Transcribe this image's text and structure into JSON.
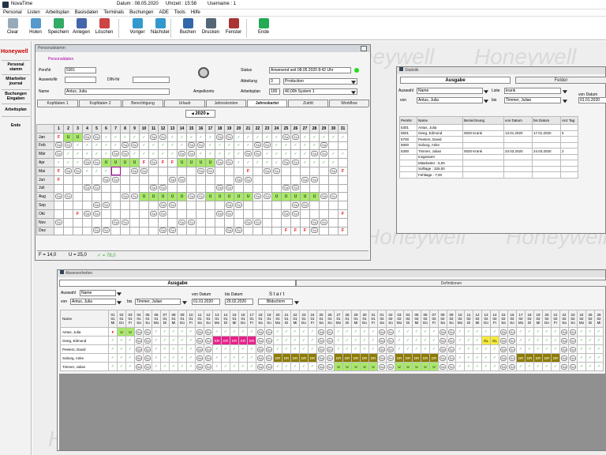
{
  "app": {
    "title": "NovaTime",
    "date_label": "Datum : 08.05.2020",
    "time_label": "Uhrzeit : 15:58",
    "user_label": "Username : 1"
  },
  "menu": [
    "Personal",
    "Listen",
    "Arbeitsplan",
    "Basisdaten",
    "Terminals",
    "Buchungen",
    "ADE",
    "Tools",
    "Hilfe"
  ],
  "toolbar": [
    {
      "name": "clear",
      "label": "Clear",
      "icon": "clear-icon",
      "color": "#9ab"
    },
    {
      "name": "holen",
      "label": "Holen",
      "icon": "fetch-icon",
      "color": "#59c"
    },
    {
      "name": "speichern",
      "label": "Speichern",
      "icon": "save-icon",
      "color": "#3a6"
    },
    {
      "name": "anlegen",
      "label": "Anlegen",
      "icon": "create-icon",
      "color": "#46a"
    },
    {
      "name": "loeschen",
      "label": "Löschen",
      "icon": "delete-icon",
      "color": "#c44"
    },
    {
      "name": "voriger",
      "label": "Voriger",
      "icon": "previous-icon",
      "color": "#39c"
    },
    {
      "name": "naechster",
      "label": "Nächster",
      "icon": "next-icon",
      "color": "#39c"
    },
    {
      "name": "buchen",
      "label": "Buchen",
      "icon": "booking-icon",
      "color": "#36a"
    },
    {
      "name": "drucken",
      "label": "Drucken",
      "icon": "print-icon",
      "color": "#567"
    },
    {
      "name": "fenster",
      "label": "Fenster",
      "icon": "window-icon",
      "color": "#a33"
    },
    {
      "name": "ende",
      "label": "Ende",
      "icon": "exit-icon",
      "color": "#2a5"
    }
  ],
  "nav": {
    "brand": "Honeywell",
    "items": [
      "Personal stamm",
      "Mitarbeiter journal",
      "Buchungen Eingaben",
      "Arbeitsplan",
      "Ende"
    ]
  },
  "watermark": "Honeywell",
  "personal": {
    "title": "Personalstamm",
    "section": "Personaldaten",
    "persnr_label": "PersNr",
    "persnr": "5301",
    "ausweis_label": "AusweisNr",
    "ausweis": "",
    "din_label": "DIN-Nr",
    "din": "",
    "name_label": "Name",
    "name": "Antus, Julia",
    "ampel_label": "Ampelkonto",
    "status_label": "Status",
    "status": "Anwesend seit  08.05.2020  8:42  Uhr",
    "abteilung_label": "Abteilung",
    "abteilung_nr": "3",
    "abteilung": "Production",
    "arbeitsplan_label": "Arbeitsplan",
    "arbeitsplan_nr": "100",
    "arbeitsplan": "40,00h System 1",
    "tabs": [
      "Kopfdaten 1",
      "Kopfdaten 2",
      "Berechtigung",
      "Urlaub",
      "Jahreskonten",
      "Jahreskartei",
      "Zutritt",
      "Workflow"
    ],
    "active_tab": 5,
    "year": "2020",
    "prev": "◀",
    "next": "▶",
    "days": [
      "1",
      "2",
      "3",
      "4",
      "5",
      "6",
      "7",
      "8",
      "9",
      "10",
      "11",
      "12",
      "13",
      "14",
      "15",
      "16",
      "17",
      "18",
      "19",
      "20",
      "21",
      "22",
      "23",
      "24",
      "25",
      "26",
      "27",
      "28",
      "29",
      "30",
      "31"
    ],
    "months": [
      {
        "m": "Jan",
        "c": [
          "F",
          "U",
          "U",
          "Sa",
          "So",
          "✓",
          "✓",
          "✓",
          "✓",
          "✓",
          "Sa",
          "So",
          "✓",
          "✓",
          "✓",
          "✓",
          "✓",
          "Sa",
          "So",
          "✓",
          "✓",
          "✓",
          "✓",
          "✓",
          "Sa",
          "So",
          "✓",
          "✓",
          "✓",
          "✓",
          "✓"
        ]
      },
      {
        "m": "Feb",
        "c": [
          "Sa",
          "So",
          "✓",
          "✓",
          "✓",
          "✓",
          "✓",
          "Sa",
          "So",
          "✓",
          "✓",
          "✓",
          "✓",
          "✓",
          "Sa",
          "So",
          "✓",
          "✓",
          "✓",
          "✓",
          "✓",
          "Sa",
          "So",
          "✓",
          "✓",
          "✓",
          "✓",
          "✓",
          "Sa",
          "",
          ""
        ]
      },
      {
        "m": "Mär",
        "c": [
          "So",
          "✓",
          "✓",
          "✓",
          "✓",
          "✓",
          "Sa",
          "So",
          "✓",
          "✓",
          "✓",
          "✓",
          "✓",
          "Sa",
          "So",
          "✓",
          "✓",
          "✓",
          "✓",
          "✓",
          "Sa",
          "So",
          "✓",
          "✓",
          "✓",
          "✓",
          "✓",
          "Sa",
          "So",
          "✓",
          "✓"
        ]
      },
      {
        "m": "Apr",
        "c": [
          "✓",
          "✓",
          "✓",
          "Sa",
          "So",
          "U",
          "U",
          "U",
          "U",
          "F",
          "Sa",
          "F",
          "F",
          "U",
          "U",
          "U",
          "U",
          "Sa",
          "So",
          "✓",
          "✓",
          "✓",
          "✓",
          "✓",
          "Sa",
          "So",
          "✓",
          "✓",
          "✓",
          "✓",
          ""
        ]
      },
      {
        "m": "Mai",
        "c": [
          "F",
          "Sa",
          "So",
          "✓",
          "✓",
          "✓",
          "#",
          "",
          "Sa",
          "So",
          "",
          "",
          "",
          "",
          "",
          "Sa",
          "So",
          "",
          "",
          "",
          "F",
          "",
          "Sa",
          "So",
          "",
          "",
          "",
          "",
          "",
          "Sa",
          "F"
        ]
      },
      {
        "m": "Jun",
        "c": [
          "F",
          "",
          "",
          "",
          "",
          "Sa",
          "So",
          "",
          "",
          "",
          "",
          "",
          "Sa",
          "So",
          "",
          "",
          "",
          "",
          "",
          "Sa",
          "So",
          "",
          "",
          "",
          "",
          "",
          "Sa",
          "So",
          "",
          "",
          ""
        ]
      },
      {
        "m": "Juli",
        "c": [
          "",
          "",
          "",
          "Sa",
          "So",
          "",
          "",
          "",
          "",
          "",
          "Sa",
          "So",
          "",
          "",
          "",
          "",
          "",
          "Sa",
          "So",
          "",
          "",
          "",
          "",
          "",
          "Sa",
          "So",
          "",
          "",
          "",
          "",
          ""
        ]
      },
      {
        "m": "Aug",
        "c": [
          "Sa",
          "So",
          "",
          "",
          "",
          "",
          "",
          "Sa",
          "So",
          "U",
          "U",
          "U",
          "U",
          "U",
          "Sa",
          "So",
          "U",
          "U",
          "U",
          "U",
          "U",
          "Sa",
          "So",
          "U",
          "U",
          "U",
          "U",
          "U",
          "Sa",
          "So",
          ""
        ]
      },
      {
        "m": "Sep",
        "c": [
          "",
          "",
          "",
          "",
          "Sa",
          "So",
          "",
          "",
          "",
          "",
          "",
          "Sa",
          "So",
          "",
          "",
          "",
          "",
          "",
          "Sa",
          "So",
          "",
          "",
          "",
          "",
          "",
          "Sa",
          "So",
          "",
          "",
          "",
          ""
        ]
      },
      {
        "m": "Okt",
        "c": [
          "",
          "",
          "F",
          "Sa",
          "So",
          "",
          "",
          "",
          "",
          "",
          "Sa",
          "So",
          "",
          "",
          "",
          "",
          "",
          "Sa",
          "So",
          "",
          "",
          "",
          "",
          "",
          "Sa",
          "So",
          "",
          "",
          "",
          "",
          "F"
        ]
      },
      {
        "m": "Nov",
        "c": [
          "So",
          "",
          "",
          "",
          "",
          "",
          "Sa",
          "So",
          "",
          "",
          "",
          "",
          "",
          "Sa",
          "So",
          "",
          "",
          "",
          "",
          "",
          "Sa",
          "So",
          "",
          "",
          "",
          "",
          "",
          "Sa",
          "So",
          "",
          ""
        ]
      },
      {
        "m": "Dez",
        "c": [
          "",
          "",
          "",
          "",
          "Sa",
          "So",
          "",
          "",
          "",
          "",
          "",
          "Sa",
          "So",
          "",
          "",
          "",
          "",
          "",
          "Sa",
          "So",
          "",
          "",
          "",
          "",
          "F",
          "F",
          "F",
          "So",
          "",
          "",
          "F"
        ]
      }
    ],
    "summary": {
      "f": "F = 14,0",
      "u": "U = 25,0",
      "ok": "✓ = 78,0"
    }
  },
  "statistik": {
    "title": "Statistik",
    "tab_ausgabe": "Ausgabe",
    "tab_felder": "Felder",
    "auswahl_label": "Auswahl",
    "auswahl": "Name",
    "liste_label": "Liste",
    "liste": "krank",
    "von_label": "von",
    "von": "Antus, Julia",
    "bis_label": "bis",
    "bis": "Timmer, Julian",
    "vondatum_label": "von Datum",
    "vondatum": "01.01.2020",
    "headers": [
      "PersNr",
      "Name",
      "Bezeichnung",
      "von Datum",
      "bis Datum",
      "Anz Tag"
    ],
    "rows": [
      [
        "5301",
        "Antus, Julia",
        "",
        "",
        "",
        ""
      ],
      [
        "5601",
        "Geeg, Edmond",
        "0020 Krank",
        "13.01.2020",
        "17.01.2020",
        "5"
      ],
      [
        "5700",
        "Peeters, David",
        "",
        "",
        "",
        ""
      ],
      [
        "5600",
        "Soburg, Anke",
        "",
        "",
        "",
        ""
      ],
      [
        "5300",
        "Timmer, Julian",
        "0020 Krank",
        "23.03.2020",
        "24.03.2020",
        "2"
      ]
    ],
    "totals": [
      [
        "",
        "Insgesamt",
        "",
        "",
        "",
        ""
      ],
      [
        "",
        "Mitarbeiter      : 5,00",
        "",
        "",
        "",
        ""
      ],
      [
        "",
        "Solltage        : 325,00",
        "",
        "",
        "",
        ""
      ],
      [
        "",
        "Fehltage         : 7,00",
        "",
        "",
        "",
        ""
      ]
    ]
  },
  "abwesenheiten": {
    "title": "Abwesenheiten",
    "tab_ausgabe": "Ausgabe",
    "tab_def": "Definitionen",
    "auswahl_label": "Auswahl",
    "auswahl": "Name",
    "von_label": "von",
    "von": "Antus, Julia",
    "bis_label": "bis",
    "bis": "Timmer, Julian",
    "vondatum_label": "von Datum",
    "vondatum": "01.01.2020",
    "bisdatum_label": "bis Datum",
    "bisdatum": "29.02.2020",
    "start_label": "S t a r t",
    "bildschirm": "Bildschirm",
    "name_header": "Name",
    "dates": [
      "01\n01\nMi",
      "02\n01\nDo",
      "03\n01\nFr",
      "04\n01\nSa",
      "05\n01\nSo",
      "06\n01\nMo",
      "07\n01\nDi",
      "08\n01\nMi",
      "09\n01\nDo",
      "10\n01\nFr",
      "11\n01\nSa",
      "12\n01\nSo",
      "13\n01\nMo",
      "14\n01\nDi",
      "15\n01\nMi",
      "16\n01\nDo",
      "17\n01\nFr",
      "18\n01\nSa",
      "19\n01\nSo",
      "20\n01\nMo",
      "21\n01\nDi",
      "22\n01\nMi",
      "23\n01\nDo",
      "24\n01\nFr",
      "25\n01\nSa",
      "26\n01\nSo",
      "27\n01\nMo",
      "28\n01\nDi",
      "29\n01\nMi",
      "30\n01\nDo",
      "31\n01\nFr",
      "01\n02\nSa",
      "02\n02\nSo",
      "03\n02\nMo",
      "04\n02\nDi",
      "05\n02\nMi",
      "06\n02\nDo",
      "07\n02\nFr",
      "08\n02\nSa",
      "09\n02\nSo",
      "10\n02\nMo",
      "11\n02\nDi",
      "12\n02\nMi",
      "13\n02\nDo",
      "14\n02\nFr",
      "15\n02\nSa",
      "16\n02\nSo",
      "17\n02\nMo",
      "18\n02\nDi",
      "19\n02\nMi",
      "20\n02\nDo",
      "21\n02\nFr",
      "22\n02\nSa",
      "23\n02\nSo",
      "24\n02\nMo",
      "25\n02\nDi",
      "26\n02\nMi"
    ],
    "rows": [
      {
        "n": "Antus, Julia",
        "c": [
          "F",
          "U",
          "U",
          "Sa",
          "So",
          "✓",
          "✓",
          "✓",
          "✓",
          "✓",
          "Sa",
          "So",
          "✓",
          "✓",
          "✓",
          "✓",
          "✓",
          "Sa",
          "So",
          "✓",
          "✓",
          "✓",
          "✓",
          "✓",
          "Sa",
          "So",
          "✓",
          "✓",
          "✓",
          "✓",
          "✓",
          "Sa",
          "So",
          "✓",
          "✓",
          "✓",
          "✓",
          "✓",
          "Sa",
          "So",
          "✓",
          "✓",
          "✓",
          "✓",
          "✓",
          "Sa",
          "So",
          "✓",
          "✓",
          "✓",
          "✓",
          "✓",
          "Sa",
          "So",
          "✓",
          "✓",
          "✓"
        ]
      },
      {
        "n": "Geeg, Edmond",
        "c": [
          "✓",
          "✓",
          "✓",
          "Sa",
          "So",
          "✓",
          "✓",
          "✓",
          "✓",
          "✓",
          "Sa",
          "So",
          "KR",
          "KR",
          "KR",
          "KR",
          "KR",
          "Sa",
          "So",
          "✓",
          "✓",
          "✓",
          "✓",
          "✓",
          "Sa",
          "So",
          "✓",
          "✓",
          "✓",
          "✓",
          "✓",
          "Sa",
          "So",
          "✓",
          "✓",
          "✓",
          "✓",
          "✓",
          "Sa",
          "So",
          "✓",
          "✓",
          "✓",
          "GL",
          "GL",
          "Sa",
          "So",
          "✓",
          "✓",
          "✓",
          "✓",
          "✓",
          "Sa",
          "So",
          "✓",
          "✓",
          "✓"
        ]
      },
      {
        "n": "Peeters, David",
        "c": [
          "✓",
          "✓",
          "✓",
          "Sa",
          "So",
          "✓",
          "✓",
          "✓",
          "✓",
          "✓",
          "Sa",
          "So",
          "✓",
          "✓",
          "✓",
          "✓",
          "✓",
          "Sa",
          "So",
          "✓",
          "✓",
          "✓",
          "✓",
          "✓",
          "Sa",
          "So",
          "✓",
          "✓",
          "✓",
          "✓",
          "✓",
          "Sa",
          "So",
          "✓",
          "✓",
          "✓",
          "✓",
          "✓",
          "Sa",
          "So",
          "✓",
          "✓",
          "✓",
          "✓",
          "✓",
          "Sa",
          "So",
          "✓",
          "✓",
          "✓",
          "✓",
          "✓",
          "Sa",
          "So",
          "✓",
          "✓",
          "✓"
        ]
      },
      {
        "n": "Soburg, Anke",
        "c": [
          "✓",
          "✓",
          "✓",
          "Sa",
          "So",
          "✓",
          "✓",
          "✓",
          "✓",
          "✓",
          "Sa",
          "So",
          "✓",
          "✓",
          "✓",
          "✓",
          "✓",
          "Sa",
          "So",
          "DR",
          "DR",
          "DR",
          "DR",
          "DR",
          "Sa",
          "So",
          "DR",
          "DR",
          "DR",
          "DR",
          "DR",
          "Sa",
          "So",
          "DR",
          "DR",
          "DR",
          "DR",
          "DR",
          "Sa",
          "So",
          "✓",
          "✓",
          "✓",
          "✓",
          "✓",
          "Sa",
          "So",
          "DR",
          "DR",
          "DR",
          "DR",
          "DR",
          "Sa",
          "So",
          "✓",
          "✓",
          "✓"
        ]
      },
      {
        "n": "Timmer, Julian",
        "c": [
          "✓",
          "✓",
          "✓",
          "Sa",
          "So",
          "✓",
          "✓",
          "✓",
          "✓",
          "✓",
          "Sa",
          "So",
          "✓",
          "✓",
          "✓",
          "✓",
          "✓",
          "Sa",
          "So",
          "✓",
          "✓",
          "✓",
          "✓",
          "✓",
          "Sa",
          "So",
          "U",
          "U",
          "U",
          "U",
          "U",
          "Sa",
          "So",
          "U",
          "U",
          "U",
          "U",
          "U",
          "Sa",
          "So",
          "✓",
          "✓",
          "✓",
          "✓",
          "✓",
          "Sa",
          "So",
          "✓",
          "✓",
          "✓",
          "✓",
          "✓",
          "Sa",
          "So",
          "✓",
          "✓",
          "✓"
        ]
      }
    ]
  }
}
